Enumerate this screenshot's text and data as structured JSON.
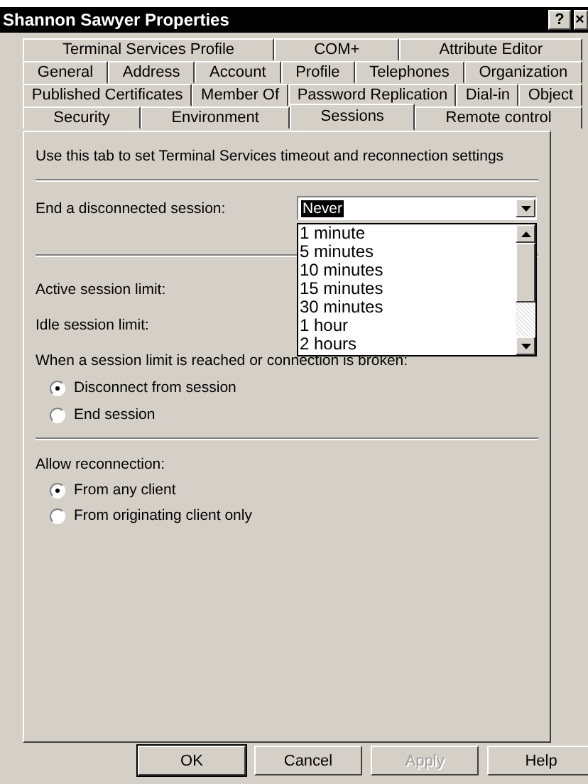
{
  "window": {
    "title": "Shannon Sawyer Properties",
    "help_button": "?",
    "close_button": "×"
  },
  "tab_rows": [
    [
      {
        "label": "Terminal Services Profile",
        "selected": false
      },
      {
        "label": "COM+",
        "selected": false
      },
      {
        "label": "Attribute Editor",
        "selected": false
      }
    ],
    [
      {
        "label": "General",
        "selected": false
      },
      {
        "label": "Address",
        "selected": false
      },
      {
        "label": "Account",
        "selected": false
      },
      {
        "label": "Profile",
        "selected": false
      },
      {
        "label": "Telephones",
        "selected": false
      },
      {
        "label": "Organization",
        "selected": false
      }
    ],
    [
      {
        "label": "Published Certificates",
        "selected": false
      },
      {
        "label": "Member Of",
        "selected": false
      },
      {
        "label": "Password Replication",
        "selected": false
      },
      {
        "label": "Dial-in",
        "selected": false
      },
      {
        "label": "Object",
        "selected": false
      }
    ],
    [
      {
        "label": "Security",
        "selected": false
      },
      {
        "label": "Environment",
        "selected": false
      },
      {
        "label": "Sessions",
        "selected": true
      },
      {
        "label": "Remote control",
        "selected": false
      }
    ]
  ],
  "intro": "Use this tab to set Terminal Services timeout and reconnection settings",
  "end_disconnected": {
    "label": "End a disconnected session:",
    "value": "Never",
    "options": [
      "1 minute",
      "5 minutes",
      "10 minutes",
      "15 minutes",
      "30 minutes",
      "1 hour",
      "2 hours"
    ]
  },
  "limits": [
    "Active session limit:",
    "Idle session limit:"
  ],
  "on_limit": {
    "label": "When a session limit is reached or connection is broken:",
    "options": [
      {
        "label": "Disconnect from session",
        "selected": true
      },
      {
        "label": "End session",
        "selected": false
      }
    ]
  },
  "reconnection": {
    "label": "Allow reconnection:",
    "options": [
      {
        "label": "From any client",
        "selected": true
      },
      {
        "label": "From originating client only",
        "selected": false
      }
    ]
  },
  "buttons": [
    {
      "label": "OK",
      "disabled": false,
      "default": true
    },
    {
      "label": "Cancel",
      "disabled": false,
      "default": false
    },
    {
      "label": "Apply",
      "disabled": true,
      "default": false
    },
    {
      "label": "Help",
      "disabled": false,
      "default": false
    }
  ]
}
